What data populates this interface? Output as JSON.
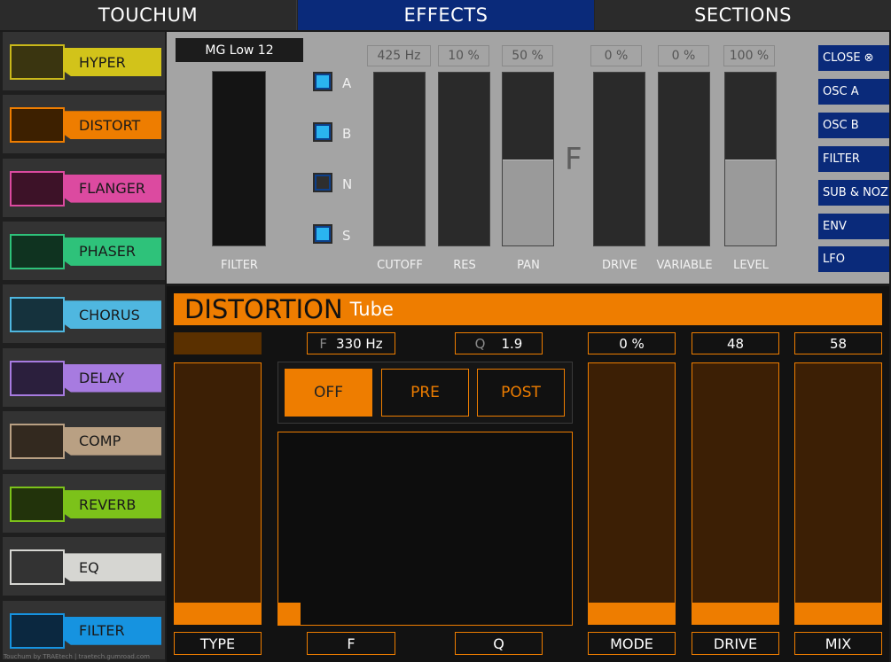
{
  "tabs": [
    "TOUCHUM",
    "EFFECTS",
    "SECTIONS"
  ],
  "sidebar": [
    {
      "label": "HYPER",
      "color": "#d2c31a",
      "swatch": "#3a3510",
      "border": "#c9b81a"
    },
    {
      "label": "DISTORT",
      "color": "#ee7d00",
      "swatch": "#3d2000",
      "border": "#ee7d00"
    },
    {
      "label": "FLANGER",
      "color": "#dc4aa0",
      "swatch": "#3d1228",
      "border": "#dc4aa0"
    },
    {
      "label": "PHASER",
      "color": "#2ec27a",
      "swatch": "#0f3320",
      "border": "#2ec27a"
    },
    {
      "label": "CHORUS",
      "color": "#4fb7e0",
      "swatch": "#15323d",
      "border": "#4fb7e0"
    },
    {
      "label": "DELAY",
      "color": "#a77be0",
      "swatch": "#2b1f3d",
      "border": "#a77be0"
    },
    {
      "label": "COMP",
      "color": "#b9a083",
      "swatch": "#33291f",
      "border": "#b9a083"
    },
    {
      "label": "REVERB",
      "color": "#7cc21a",
      "swatch": "#22330b",
      "border": "#7cc21a"
    },
    {
      "label": "EQ",
      "color": "#d6d6d2",
      "swatch": "#333333",
      "border": "#d6d6d2"
    },
    {
      "label": "FILTER",
      "color": "#1693e0",
      "swatch": "#0b2840",
      "border": "#1693e0"
    }
  ],
  "credit": "Touchum by TRAEtech | traetech.gumroad.com",
  "filter": {
    "preset": "MG Low 12",
    "label": "FILTER",
    "routing": [
      {
        "label": "A",
        "on": true
      },
      {
        "label": "B",
        "on": true
      },
      {
        "label": "N",
        "on": false
      },
      {
        "label": "S",
        "on": true
      }
    ],
    "big_letter": "F",
    "sliders": [
      {
        "value": "425  Hz",
        "label": "CUTOFF",
        "level": 0
      },
      {
        "value": "10 %",
        "label": "RES",
        "level": 0
      },
      {
        "value": "50 %",
        "label": "PAN",
        "level": 0.5
      },
      {
        "value": "0 %",
        "label": "DRIVE",
        "level": 0
      },
      {
        "value": "0 %",
        "label": "VARIABLE",
        "level": 0
      },
      {
        "value": "100 %",
        "label": "LEVEL",
        "level": 0.5
      }
    ]
  },
  "sections": [
    "CLOSE ⊗",
    "OSC A",
    "OSC B",
    "FILTER",
    "SUB & NOZ",
    "ENV",
    "LFO"
  ],
  "distortion": {
    "title": "DISTORTION",
    "type_name": "Tube",
    "f_prefix": "F",
    "f_value": "330  Hz",
    "q_prefix": "Q",
    "q_value": "1.9",
    "modes": [
      "OFF",
      "PRE",
      "POST"
    ],
    "active_mode": "OFF",
    "mode_value": "0 %",
    "drive_value": "48",
    "mix_value": "58",
    "bottom_labels": [
      "TYPE",
      "F",
      "Q",
      "MODE",
      "DRIVE",
      "MIX"
    ]
  },
  "accent": "#ee7d00"
}
